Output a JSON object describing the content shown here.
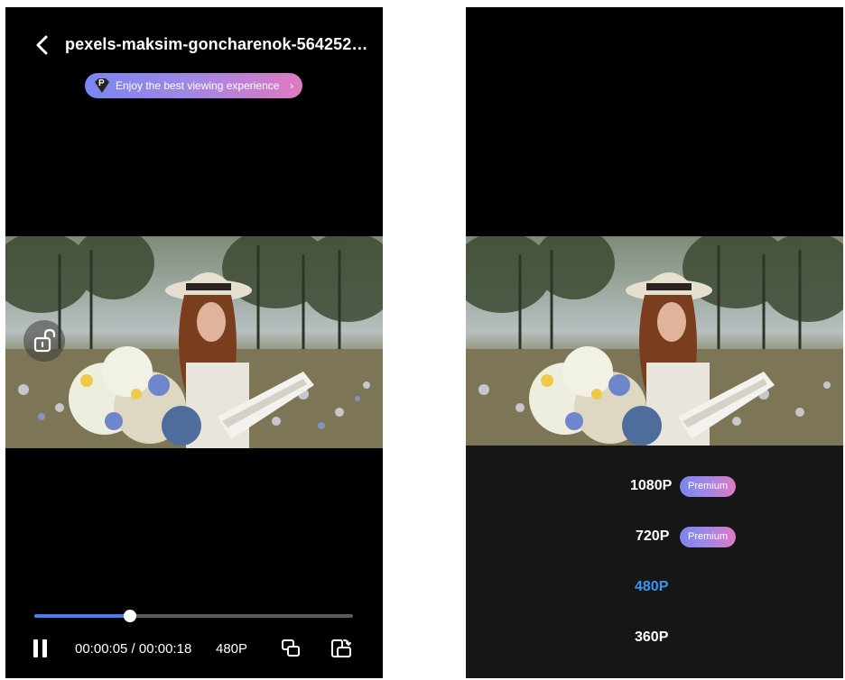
{
  "player": {
    "title": "pexels-maksim-goncharenok-5642523....",
    "promo_text": "Enjoy the best viewing experience",
    "promo_badge": "P",
    "promo_chevron": "›",
    "current_time": "00:00:05",
    "duration": "00:00:18",
    "time_display": "00:00:05 / 00:00:18",
    "quality": "480P",
    "progress_fraction": 0.3
  },
  "quality_menu": {
    "options": [
      {
        "label": "1080P",
        "badge": "Premium",
        "selected": false
      },
      {
        "label": "720P",
        "badge": "Premium",
        "selected": false
      },
      {
        "label": "480P",
        "badge": "",
        "selected": true
      },
      {
        "label": "360P",
        "badge": "",
        "selected": false
      }
    ]
  },
  "colors": {
    "accent_blue": "#3f82f6",
    "selected_quality": "#3a95f0",
    "premium_gradient_start": "#7a86f0",
    "premium_gradient_end": "#e07ac0",
    "panel_bg": "#161616"
  },
  "icons": [
    "back-icon",
    "diamond-icon",
    "lock-open-icon",
    "pause-icon",
    "pip-icon",
    "rotate-screen-icon"
  ]
}
